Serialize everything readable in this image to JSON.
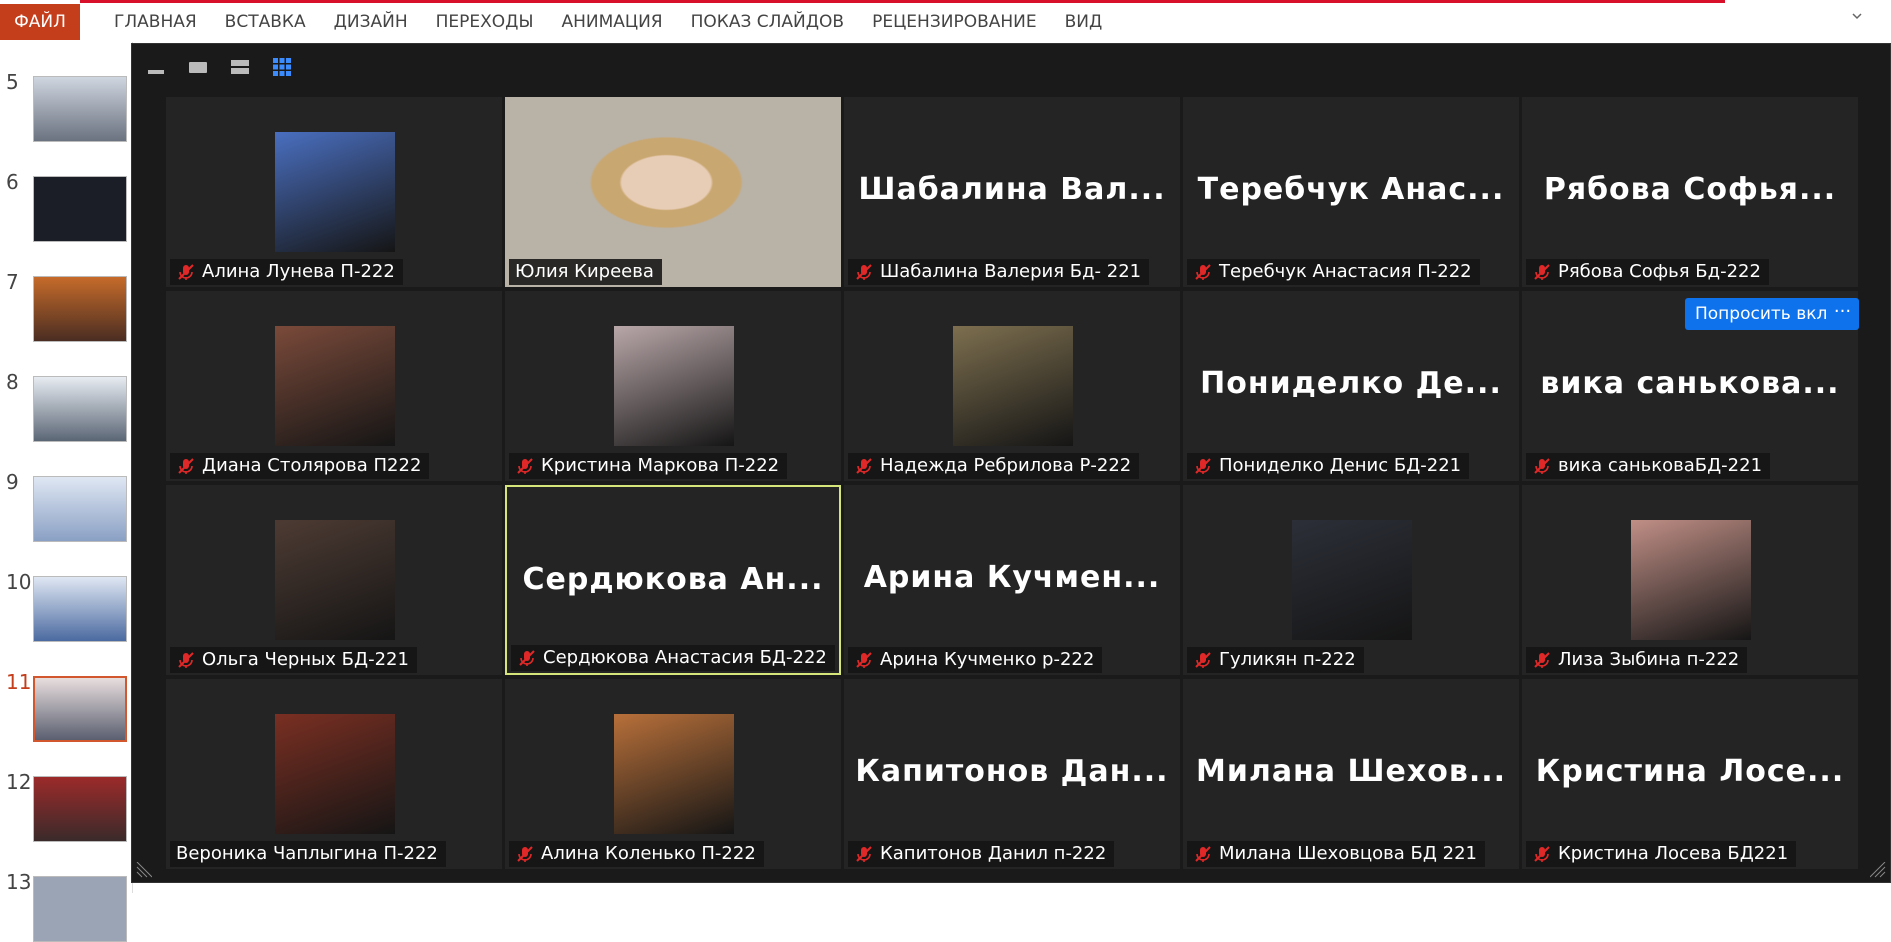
{
  "ribbon": {
    "file_tab": "ФАЙЛ",
    "tabs": [
      "ГЛАВНАЯ",
      "ВСТАВКА",
      "ДИЗАЙН",
      "ПЕРЕХОДЫ",
      "АНИМАЦИЯ",
      "ПОКАЗ СЛАЙДОВ",
      "РЕЦЕНЗИРОВАНИЕ",
      "ВИД"
    ]
  },
  "slides": {
    "numbers": [
      "5",
      "6",
      "7",
      "8",
      "9",
      "10",
      "11",
      "12",
      "13"
    ],
    "active": "11"
  },
  "zoom": {
    "ask_button": "Попросить вкл",
    "more_button": "···",
    "participants": [
      {
        "label": "Алина Лунева П-222",
        "muted": true,
        "display": "photo",
        "color": "#4a6fc0"
      },
      {
        "label": "Юлия Киреева",
        "muted": false,
        "display": "video",
        "color": "#b9b2a6"
      },
      {
        "label": "Шабалина Валерия Бд- 221",
        "muted": true,
        "display": "name",
        "big": "Шабалина Вал..."
      },
      {
        "label": "Теребчук Анастасия П-222",
        "muted": true,
        "display": "name",
        "big": "Теребчук Анас..."
      },
      {
        "label": "Рябова Софья Бд-222",
        "muted": true,
        "display": "name",
        "big": "Рябова Софья..."
      },
      {
        "label": "Диана Столярова П222",
        "muted": true,
        "display": "photo",
        "color": "#7a4a3a"
      },
      {
        "label": "Кристина Маркова П-222",
        "muted": true,
        "display": "photo",
        "color": "#b9a7a9"
      },
      {
        "label": "Надежда Ребрилова Р-222",
        "muted": true,
        "display": "photo",
        "color": "#7d6f4f"
      },
      {
        "label": "Пониделко Денис БД-221",
        "muted": true,
        "display": "name",
        "big": "Пониделко Де..."
      },
      {
        "label": "вика саньковаБД-221",
        "muted": true,
        "display": "name",
        "big": "вика санькова..."
      },
      {
        "label": "Ольга Черных БД-221",
        "muted": true,
        "display": "photo",
        "color": "#4d3b33"
      },
      {
        "label": "Сердюкова Анастасия БД-222",
        "muted": true,
        "display": "name",
        "big": "Сердюкова Ан...",
        "active": true
      },
      {
        "label": "Арина Кучменко р-222",
        "muted": true,
        "display": "name",
        "big": "Арина Кучмен..."
      },
      {
        "label": "Гуликян п-222",
        "muted": true,
        "display": "photo",
        "color": "#2c2f38"
      },
      {
        "label": "Лиза Зыбина п-222",
        "muted": true,
        "display": "photo",
        "color": "#c08f86"
      },
      {
        "label": "Вероника Чаплыгина П-222",
        "muted": false,
        "display": "photo",
        "color": "#7a2f22"
      },
      {
        "label": "Алина Коленько П-222",
        "muted": true,
        "display": "photo",
        "color": "#b8703a"
      },
      {
        "label": "Капитонов Данил п-222",
        "muted": true,
        "display": "name",
        "big": "Капитонов Дан..."
      },
      {
        "label": "Милана Шеховцова БД 221",
        "muted": true,
        "display": "name",
        "big": "Милана Шехов..."
      },
      {
        "label": "Кристина Лосева БД221",
        "muted": true,
        "display": "name",
        "big": "Кристина Лосе..."
      }
    ]
  },
  "colors": {
    "file_tab": "#c43e1c",
    "accent_bar": "#d8102a",
    "zoom_bg": "#1a1a1a",
    "tile_bg": "#242424",
    "active_border": "#d6e57a",
    "button_blue": "#0e72ed",
    "mute_red": "#e02828"
  }
}
